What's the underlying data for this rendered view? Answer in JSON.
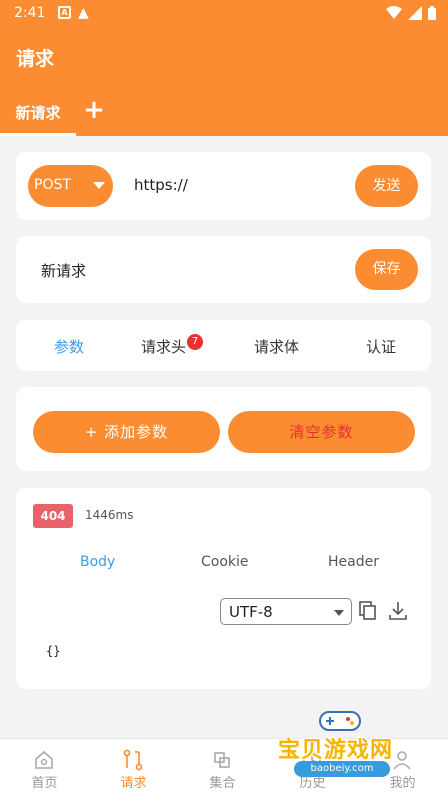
{
  "status_bar": {
    "time": "2:41",
    "indicator_a": "A",
    "indicator_warning": "▲"
  },
  "app": {
    "title": "请求",
    "tabs": [
      {
        "label": "新请求"
      }
    ],
    "add_tab_label": "+"
  },
  "request": {
    "method": "POST",
    "url": "https://",
    "send_label": "发送"
  },
  "name_row": {
    "name": "新请求",
    "save_label": "保存"
  },
  "param_tabs": {
    "items": [
      {
        "label": "参数",
        "active": true
      },
      {
        "label": "请求头",
        "badge": "7"
      },
      {
        "label": "请求体"
      },
      {
        "label": "认证"
      }
    ]
  },
  "params": {
    "add_label": "+ 添加参数",
    "clear_label": "清空参数"
  },
  "response": {
    "status_code": "404",
    "elapsed": "1446ms",
    "tabs": [
      {
        "label": "Body",
        "active": true
      },
      {
        "label": "Cookie"
      },
      {
        "label": "Header"
      }
    ],
    "encoding": "UTF-8",
    "body": "{}"
  },
  "bottom_nav": {
    "items": [
      {
        "label": "首页",
        "icon": "home-icon"
      },
      {
        "label": "请求",
        "icon": "request-icon",
        "active": true
      },
      {
        "label": "集合",
        "icon": "collection-icon"
      },
      {
        "label": "历史",
        "icon": "history-icon"
      },
      {
        "label": "我的",
        "icon": "profile-icon"
      }
    ]
  },
  "watermark": {
    "title": "宝贝游戏网",
    "domain": "baobeiy.com"
  },
  "colors": {
    "accent": "#fb8c32",
    "active_tab_text": "#3d9be9",
    "clear_text": "#e8322e",
    "error_status": "#e8626a",
    "badge": "#e8322e"
  }
}
